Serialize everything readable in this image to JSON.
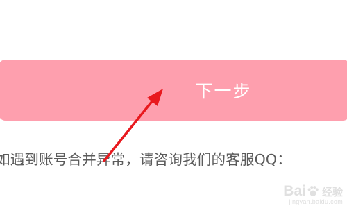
{
  "next_button": {
    "label": "下一步"
  },
  "notice": {
    "text": "如遇到账号合并异常，请咨询我们的客服QQ："
  },
  "watermark": {
    "logo_left": "Bai",
    "logo_right": "经验",
    "url": "jingyan.baidu.com"
  },
  "colors": {
    "button": "#fe9fae",
    "arrow": "#e8191e",
    "text": "#5b5b5b"
  }
}
